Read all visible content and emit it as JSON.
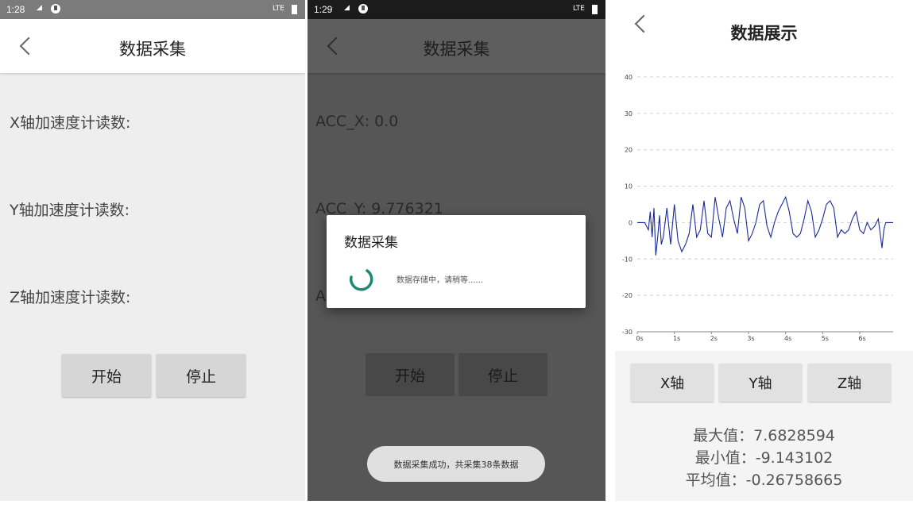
{
  "screen1": {
    "status": {
      "time": "1:28",
      "signal": "²⁄ıl",
      "network": "LTE"
    },
    "title": "数据采集",
    "readings": [
      "X轴加速度计读数:",
      "Y轴加速度计读数:",
      "Z轴加速度计读数:"
    ],
    "start_label": "开始",
    "stop_label": "停止"
  },
  "screen2": {
    "status": {
      "time": "1:29",
      "signal": "²⁄ıl",
      "network": "LTE"
    },
    "title": "数据采集",
    "readings": [
      "ACC_X: 0.0",
      "ACC_Y: 9.776321",
      "A"
    ],
    "start_label": "开始",
    "stop_label": "停止",
    "dialog": {
      "title": "数据采集",
      "message": "数据存储中，请稍等......"
    },
    "toast": "数据采集成功，共采集38条数据"
  },
  "screen3": {
    "title": "数据展示",
    "buttons": [
      "X轴",
      "Y轴",
      "Z轴"
    ],
    "stats": {
      "max": "最大值：7.6828594",
      "min": "最小值：-9.143102",
      "avg": "平均值：-0.26758665"
    }
  },
  "colors": {
    "line": "#1a2a9a",
    "accent": "#1a8a72"
  },
  "chart_data": {
    "type": "line",
    "title": "",
    "xlabel": "",
    "ylabel": "",
    "ylim": [
      -30,
      40
    ],
    "xlim": [
      0,
      6.9
    ],
    "yticks": [
      "40",
      "30",
      "20",
      "10",
      "0",
      "-10",
      "-20",
      "-30"
    ],
    "xticks": [
      "0s",
      "1s",
      "2s",
      "3s",
      "4s",
      "5s",
      "6s"
    ],
    "grid": "dashed horizontal",
    "series": [
      {
        "x": [
          0,
          0.2,
          0.3,
          0.35,
          0.4,
          0.45,
          0.5,
          0.55,
          0.6,
          0.65,
          0.7,
          0.75,
          0.8,
          0.9,
          1.0,
          1.1,
          1.2,
          1.3,
          1.4,
          1.5,
          1.6,
          1.7,
          1.8,
          1.9,
          2.0,
          2.1,
          2.2,
          2.3,
          2.4,
          2.5,
          2.6,
          2.7,
          2.8,
          2.9,
          3.0,
          3.1,
          3.2,
          3.3,
          3.4,
          3.5,
          3.6,
          3.7,
          3.8,
          3.9,
          4.0,
          4.1,
          4.2,
          4.3,
          4.4,
          4.5,
          4.6,
          4.7,
          4.8,
          4.9,
          5.0,
          5.1,
          5.2,
          5.3,
          5.4,
          5.5,
          5.6,
          5.7,
          5.8,
          5.9,
          6.0,
          6.1,
          6.2,
          6.3,
          6.4,
          6.5,
          6.6,
          6.65,
          6.7,
          6.8,
          6.9
        ],
        "y": [
          0,
          0,
          -2,
          3,
          -4,
          4,
          -9,
          -4,
          2,
          -6,
          -4,
          0,
          4,
          -6,
          5,
          -5,
          -8,
          -6,
          -3,
          5,
          -4,
          -2,
          6,
          -3,
          -4,
          7,
          1,
          -4,
          4,
          6,
          1,
          -3,
          7,
          4,
          -5,
          -3,
          0,
          5,
          6,
          -1,
          -4,
          0,
          3,
          5,
          7,
          3,
          -3,
          -4,
          -3,
          1,
          6,
          3,
          -4,
          -2,
          1,
          5,
          6,
          4,
          -4,
          -2,
          -3,
          -2,
          1,
          3,
          -2,
          -3,
          0,
          -2,
          -1,
          1,
          -7,
          -2,
          0,
          0,
          0
        ]
      }
    ]
  }
}
